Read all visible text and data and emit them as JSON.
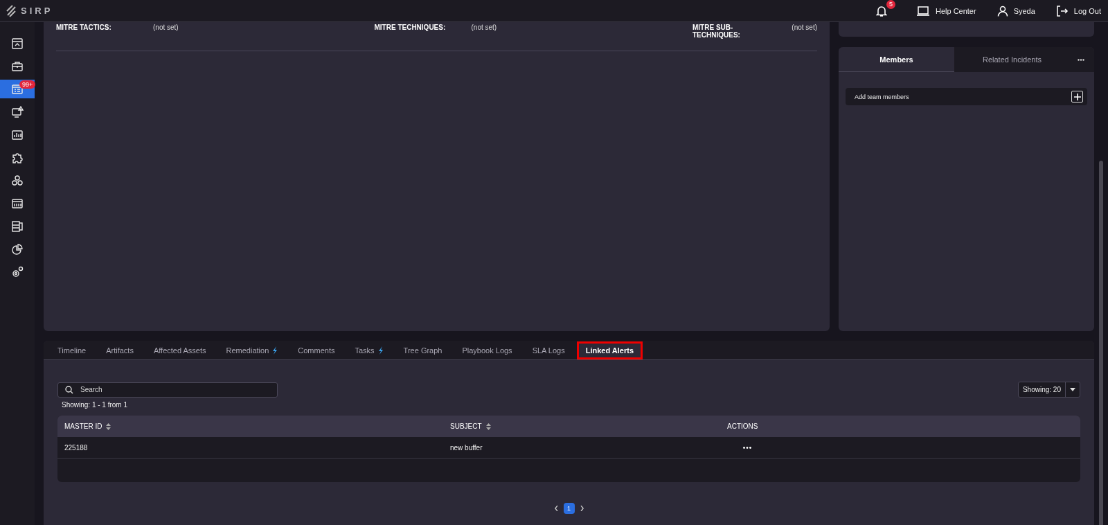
{
  "header": {
    "logo": "SIRP",
    "notifications": "5",
    "help": "Help Center",
    "user": "Syeda",
    "logout": "Log Out"
  },
  "sidebar": {
    "items": [
      {
        "kind": "dashboard",
        "selected": false
      },
      {
        "kind": "briefcase",
        "selected": false
      },
      {
        "kind": "incidents",
        "selected": true,
        "badge": "99+"
      },
      {
        "kind": "monitor-alert",
        "selected": false
      },
      {
        "kind": "chart",
        "selected": false
      },
      {
        "kind": "puzzle",
        "selected": false
      },
      {
        "kind": "cubes",
        "selected": false
      },
      {
        "kind": "panel",
        "selected": false
      },
      {
        "kind": "server",
        "selected": false
      },
      {
        "kind": "pie",
        "selected": false
      },
      {
        "kind": "gears",
        "selected": false
      }
    ]
  },
  "mitre": [
    {
      "label": "MITRE TACTICS:",
      "value": "(not set)"
    },
    {
      "label": "MITRE TECHNIQUES:",
      "value": "(not set)"
    },
    {
      "label": "MITRE SUB-TECHNIQUES:",
      "value": "(not set)"
    }
  ],
  "side_panel": {
    "tabs": [
      {
        "label": "Members",
        "selected": true
      },
      {
        "label": "Related Incidents",
        "selected": false
      }
    ],
    "add_members": "Add team members"
  },
  "tabs": [
    {
      "label": "Timeline",
      "selected": false,
      "kind": "plain"
    },
    {
      "label": "Artifacts",
      "selected": false,
      "kind": "plain"
    },
    {
      "label": "Affected Assets",
      "selected": false,
      "kind": "plain"
    },
    {
      "label": "Remediation",
      "selected": false,
      "kind": "automated"
    },
    {
      "label": "Comments",
      "selected": false,
      "kind": "plain"
    },
    {
      "label": "Tasks",
      "selected": false,
      "kind": "automated"
    },
    {
      "label": "Tree Graph",
      "selected": false,
      "kind": "plain"
    },
    {
      "label": "Playbook Logs",
      "selected": false,
      "kind": "plain"
    },
    {
      "label": "SLA Logs",
      "selected": false,
      "kind": "plain"
    },
    {
      "label": "Linked Alerts",
      "selected": true,
      "kind": "plain"
    }
  ],
  "search": {
    "placeholder": "Search"
  },
  "showing": "Showing: 1 - 1 from 1",
  "page_size": "Showing: 20",
  "table": {
    "columns": [
      {
        "label": "MASTER ID",
        "sortable": true
      },
      {
        "label": "SUBJECT",
        "sortable": true
      },
      {
        "label": "ACTIONS",
        "sortable": false
      }
    ],
    "rows": [
      {
        "master_id": "225188",
        "subject": "new buffer"
      }
    ]
  },
  "pagination": {
    "pages": [
      {
        "label": "1",
        "selected": true
      }
    ]
  }
}
